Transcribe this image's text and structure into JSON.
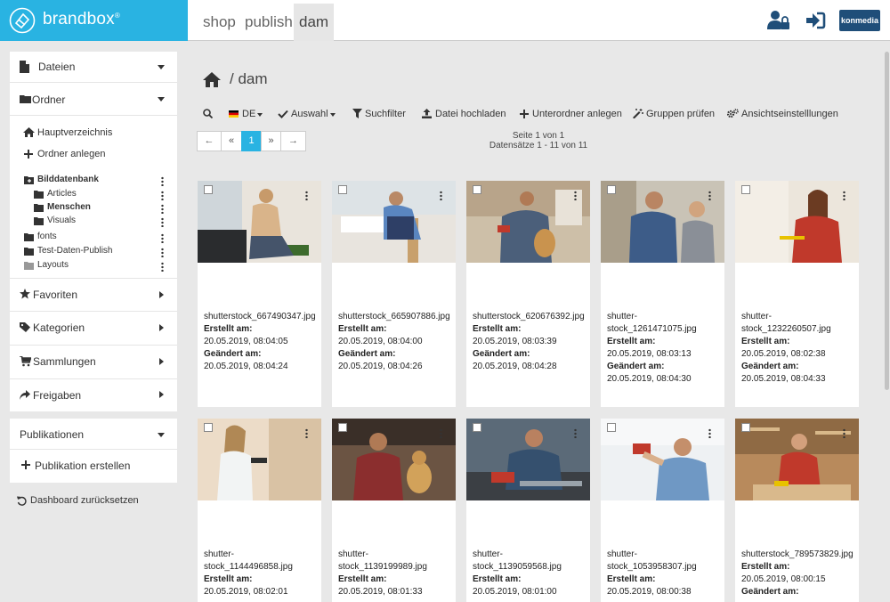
{
  "app": {
    "brand_name": "brandbox",
    "brand_mark": "®"
  },
  "nav": {
    "tabs": [
      {
        "label": "shop"
      },
      {
        "label": "publish"
      },
      {
        "label": "dam"
      }
    ]
  },
  "header": {
    "partner_badge": "konmedia"
  },
  "sidebar": {
    "files_title": "Dateien",
    "folders_title": "Ordner",
    "main_directory": "Hauptverzeichnis",
    "create_folder": "Ordner anlegen",
    "tree": [
      {
        "label": "Bilddatenbank",
        "bold": true
      },
      {
        "label": "Articles",
        "bold": false
      },
      {
        "label": "Menschen",
        "bold": true
      },
      {
        "label": "Visuals",
        "bold": false
      },
      {
        "label": "fonts",
        "bold": false
      },
      {
        "label": "Test-Daten-Publish",
        "bold": false
      },
      {
        "label": "Layouts",
        "bold": false
      }
    ],
    "sections": [
      {
        "label": "Favoriten"
      },
      {
        "label": "Kategorien"
      },
      {
        "label": "Sammlungen"
      },
      {
        "label": "Freigaben"
      }
    ],
    "publications_title": "Publikationen",
    "create_publication": "Publikation erstellen",
    "reset_dashboard": "Dashboard zurücksetzen"
  },
  "breadcrumb": {
    "path": "/ dam"
  },
  "toolbar": {
    "language": "DE",
    "selection": "Auswahl",
    "search_filter": "Suchfilter",
    "upload": "Datei hochladen",
    "create_subfolder": "Unterordner anlegen",
    "check_groups": "Gruppen prüfen",
    "view_settings": "Ansichtseinstelllungen"
  },
  "pagination": {
    "first": "←",
    "prev": "«",
    "current": "1",
    "next": "»",
    "last": "→",
    "page_info": "Seite 1 von 1",
    "records_info": "Datensätze 1 - 11 von 11"
  },
  "labels": {
    "created": "Erstellt am:",
    "modified": "Geändert am:"
  },
  "files": [
    {
      "name": "shutterstock_667490347.jpg",
      "created": "20.05.2019, 08:04:05",
      "modified": "20.05.2019, 08:04:24"
    },
    {
      "name": "shutterstock_665907886.jpg",
      "created": "20.05.2019, 08:04:00",
      "modified": "20.05.2019, 08:04:26"
    },
    {
      "name": "shutterstock_620676392.jpg",
      "created": "20.05.2019, 08:03:39",
      "modified": "20.05.2019, 08:04:28"
    },
    {
      "name": "shutter-\nstock_1261471075.jpg",
      "created": "20.05.2019, 08:03:13",
      "modified": "20.05.2019, 08:04:30"
    },
    {
      "name": "shutter-\nstock_1232260507.jpg",
      "created": "20.05.2019, 08:02:38",
      "modified": "20.05.2019, 08:04:33"
    },
    {
      "name": "shutter-\nstock_1144496858.jpg",
      "created": "20.05.2019, 08:02:01",
      "modified": ""
    },
    {
      "name": "shutter-\nstock_1139199989.jpg",
      "created": "20.05.2019, 08:01:33",
      "modified": ""
    },
    {
      "name": "shutter-\nstock_1139059568.jpg",
      "created": "20.05.2019, 08:01:00",
      "modified": ""
    },
    {
      "name": "shutter-\nstock_1053958307.jpg",
      "created": "20.05.2019, 08:00:38",
      "modified": ""
    },
    {
      "name": "shutterstock_789573829.jpg",
      "created": "20.05.2019, 08:00:15",
      "modified": ""
    }
  ],
  "colors": {
    "brand": "#29b3e2",
    "badge": "#1f4e79"
  }
}
